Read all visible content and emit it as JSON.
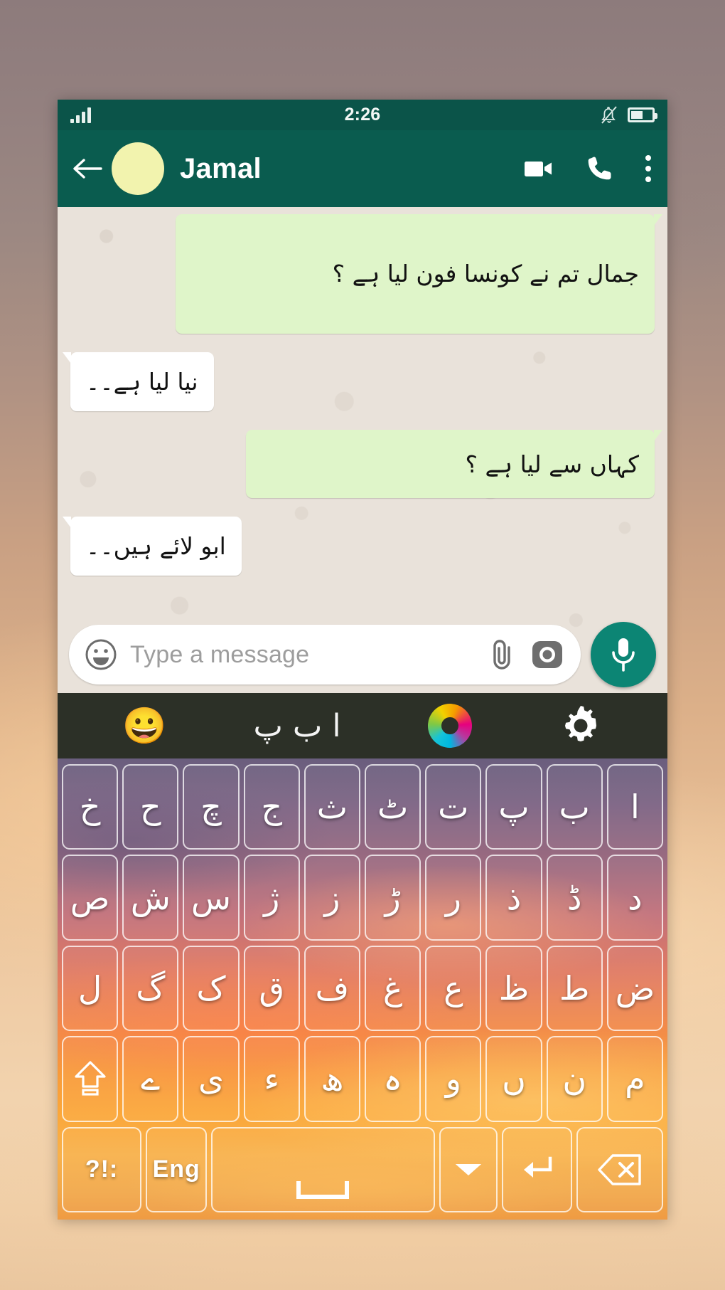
{
  "status_bar": {
    "time": "2:26",
    "signal_icon": "signal-bars-icon",
    "mute_icon": "bell-muted-icon",
    "battery_icon": "battery-icon",
    "battery_level_percent": 58,
    "background_color": "#0b5449"
  },
  "chat_header": {
    "back_icon": "back-arrow-icon",
    "avatar_icon": "contact-avatar",
    "avatar_color": "#f2f3ae",
    "contact_name": "Jamal",
    "video_call_icon": "video-camera-icon",
    "voice_call_icon": "phone-icon",
    "overflow_icon": "more-vertical-icon",
    "background_color": "#0a5c4f"
  },
  "chat": {
    "background_color": "#e9e2da",
    "outgoing_bubble_color": "#dff5c9",
    "incoming_bubble_color": "#ffffff",
    "messages": [
      {
        "id": "m0",
        "direction": "out",
        "text": "جمال تم نے کونسا فون لیا ہے ؟"
      },
      {
        "id": "m1",
        "direction": "in",
        "text": "نیا لیا ہے۔۔"
      },
      {
        "id": "m2",
        "direction": "out",
        "text": "کہاں سے لیا ہے ؟"
      },
      {
        "id": "m3",
        "direction": "in",
        "text": "ابو لائے ہیں۔۔"
      }
    ]
  },
  "composer": {
    "emoji_icon": "emoji-smiley-icon",
    "placeholder": "Type a message",
    "value": "",
    "attach_icon": "paperclip-icon",
    "camera_icon": "camera-icon",
    "mic_icon": "microphone-icon",
    "mic_button_color": "#0c8574"
  },
  "keyboard_toolbar": {
    "background_color": "#2c3027",
    "emoji_button": "😀",
    "emoji_icon": "emoji-grinning-icon",
    "language_label": "ا ب پ",
    "app_logo_icon": "keyboard-app-logo-icon",
    "settings_icon": "gear-icon"
  },
  "keyboard": {
    "layout": "urdu",
    "rows": [
      {
        "keys": [
          {
            "label": "ا",
            "name": "key-alef"
          },
          {
            "label": "ب",
            "name": "key-beh"
          },
          {
            "label": "پ",
            "name": "key-peh"
          },
          {
            "label": "ت",
            "name": "key-teh"
          },
          {
            "label": "ٹ",
            "name": "key-tteh"
          },
          {
            "label": "ث",
            "name": "key-theh"
          },
          {
            "label": "ج",
            "name": "key-jeem"
          },
          {
            "label": "چ",
            "name": "key-cheh"
          },
          {
            "label": "ح",
            "name": "key-hah"
          },
          {
            "label": "خ",
            "name": "key-khah"
          }
        ]
      },
      {
        "keys": [
          {
            "label": "د",
            "name": "key-dal"
          },
          {
            "label": "ڈ",
            "name": "key-ddal"
          },
          {
            "label": "ذ",
            "name": "key-thal"
          },
          {
            "label": "ر",
            "name": "key-reh"
          },
          {
            "label": "ڑ",
            "name": "key-rreh"
          },
          {
            "label": "ز",
            "name": "key-zain"
          },
          {
            "label": "ژ",
            "name": "key-jeh"
          },
          {
            "label": "س",
            "name": "key-seen"
          },
          {
            "label": "ش",
            "name": "key-sheen"
          },
          {
            "label": "ص",
            "name": "key-sad"
          }
        ]
      },
      {
        "keys": [
          {
            "label": "ض",
            "name": "key-dad"
          },
          {
            "label": "ط",
            "name": "key-tah"
          },
          {
            "label": "ظ",
            "name": "key-zah"
          },
          {
            "label": "ع",
            "name": "key-ain"
          },
          {
            "label": "غ",
            "name": "key-ghain"
          },
          {
            "label": "ف",
            "name": "key-feh"
          },
          {
            "label": "ق",
            "name": "key-qaf"
          },
          {
            "label": "ک",
            "name": "key-kaf"
          },
          {
            "label": "گ",
            "name": "key-gaf"
          },
          {
            "label": "ل",
            "name": "key-lam"
          }
        ]
      },
      {
        "keys": [
          {
            "label": "م",
            "name": "key-meem"
          },
          {
            "label": "ن",
            "name": "key-noon"
          },
          {
            "label": "ں",
            "name": "key-noon-ghunna"
          },
          {
            "label": "و",
            "name": "key-waw"
          },
          {
            "label": "ہ",
            "name": "key-heh-goal"
          },
          {
            "label": "ھ",
            "name": "key-heh-doachashmee"
          },
          {
            "label": "ء",
            "name": "key-hamza"
          },
          {
            "label": "ی",
            "name": "key-yeh"
          },
          {
            "label": "ے",
            "name": "key-yeh-barree"
          },
          {
            "label": "",
            "name": "key-shift",
            "icon": "shift-up-arrow-icon"
          }
        ]
      },
      {
        "keys": [
          {
            "label": "",
            "name": "key-backspace",
            "icon": "backspace-delete-icon"
          },
          {
            "label": "",
            "name": "key-enter",
            "icon": "enter-return-icon"
          },
          {
            "label": "",
            "name": "key-hide-keyboard",
            "icon": "chevron-down-icon"
          },
          {
            "label": "",
            "name": "key-space",
            "icon": "spacebar-icon"
          },
          {
            "label": "Eng",
            "name": "key-language-eng"
          },
          {
            "label": ":!?",
            "name": "key-symbols"
          }
        ]
      }
    ]
  }
}
